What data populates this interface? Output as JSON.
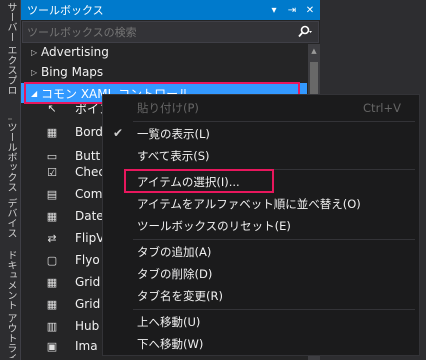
{
  "rail": {
    "tabs": [
      "サーバー エクスプローラー",
      "ツールボックス",
      "デバイス",
      "ドキュメント アウトライン"
    ]
  },
  "toolbox": {
    "title": "ツールボックス",
    "pin_glyph": "⇥",
    "close_glyph": "✕",
    "dropdown_glyph": "▾",
    "search_placeholder": "ツールボックスの検索",
    "groups": [
      {
        "label": "Advertising",
        "expanded": false
      },
      {
        "label": "Bing Maps",
        "expanded": false
      },
      {
        "label": "コモン XAML コントロール",
        "expanded": true,
        "selected": true
      }
    ],
    "items": [
      {
        "label": "ポイン",
        "icon": "pointer-icon",
        "glyph": "↖"
      },
      {
        "label": "Bord",
        "icon": "border-icon",
        "glyph": "▦"
      },
      {
        "label": "Butt",
        "icon": "button-icon",
        "glyph": "▭"
      },
      {
        "label": "Chec",
        "icon": "checkbox-icon",
        "glyph": "☑"
      },
      {
        "label": "Com",
        "icon": "combobox-icon",
        "glyph": "▤"
      },
      {
        "label": "Date",
        "icon": "datepicker-icon",
        "glyph": "▦"
      },
      {
        "label": "FlipV",
        "icon": "flipview-icon",
        "glyph": "⇄"
      },
      {
        "label": "Flyo",
        "icon": "flyout-icon",
        "glyph": "▢"
      },
      {
        "label": "Grid",
        "icon": "grid-icon",
        "glyph": "▦"
      },
      {
        "label": "Grid",
        "icon": "gridview-icon",
        "glyph": "▦"
      },
      {
        "label": "Hub",
        "icon": "hub-icon",
        "glyph": "▥"
      },
      {
        "label": "Ima",
        "icon": "image-icon",
        "glyph": "▣"
      }
    ]
  },
  "context_menu": {
    "items": [
      {
        "label": "貼り付け(P)",
        "shortcut": "Ctrl+V",
        "enabled": false,
        "checked": false
      },
      {
        "label": "一覧の表示(L)",
        "shortcut": "",
        "enabled": true,
        "checked": true
      },
      {
        "label": "すべて表示(S)",
        "shortcut": "",
        "enabled": true,
        "checked": false
      },
      {
        "label": "アイテムの選択(I)...",
        "shortcut": "",
        "enabled": true,
        "checked": false,
        "highlighted": true
      },
      {
        "label": "アイテムをアルファベット順に並べ替え(O)",
        "shortcut": "",
        "enabled": true,
        "checked": false
      },
      {
        "label": "ツールボックスのリセット(E)",
        "shortcut": "",
        "enabled": true,
        "checked": false
      },
      {
        "label": "タブの追加(A)",
        "shortcut": "",
        "enabled": true,
        "checked": false
      },
      {
        "label": "タブの削除(D)",
        "shortcut": "",
        "enabled": true,
        "checked": false
      },
      {
        "label": "タブ名を変更(R)",
        "shortcut": "",
        "enabled": true,
        "checked": false
      },
      {
        "label": "上へ移動(U)",
        "shortcut": "",
        "enabled": true,
        "checked": false
      },
      {
        "label": "下へ移動(W)",
        "shortcut": "",
        "enabled": true,
        "checked": false
      }
    ]
  },
  "colors": {
    "accent": "#007acc",
    "selection": "#3399ff",
    "highlight_box": "#e8175d",
    "background": "#252526"
  }
}
